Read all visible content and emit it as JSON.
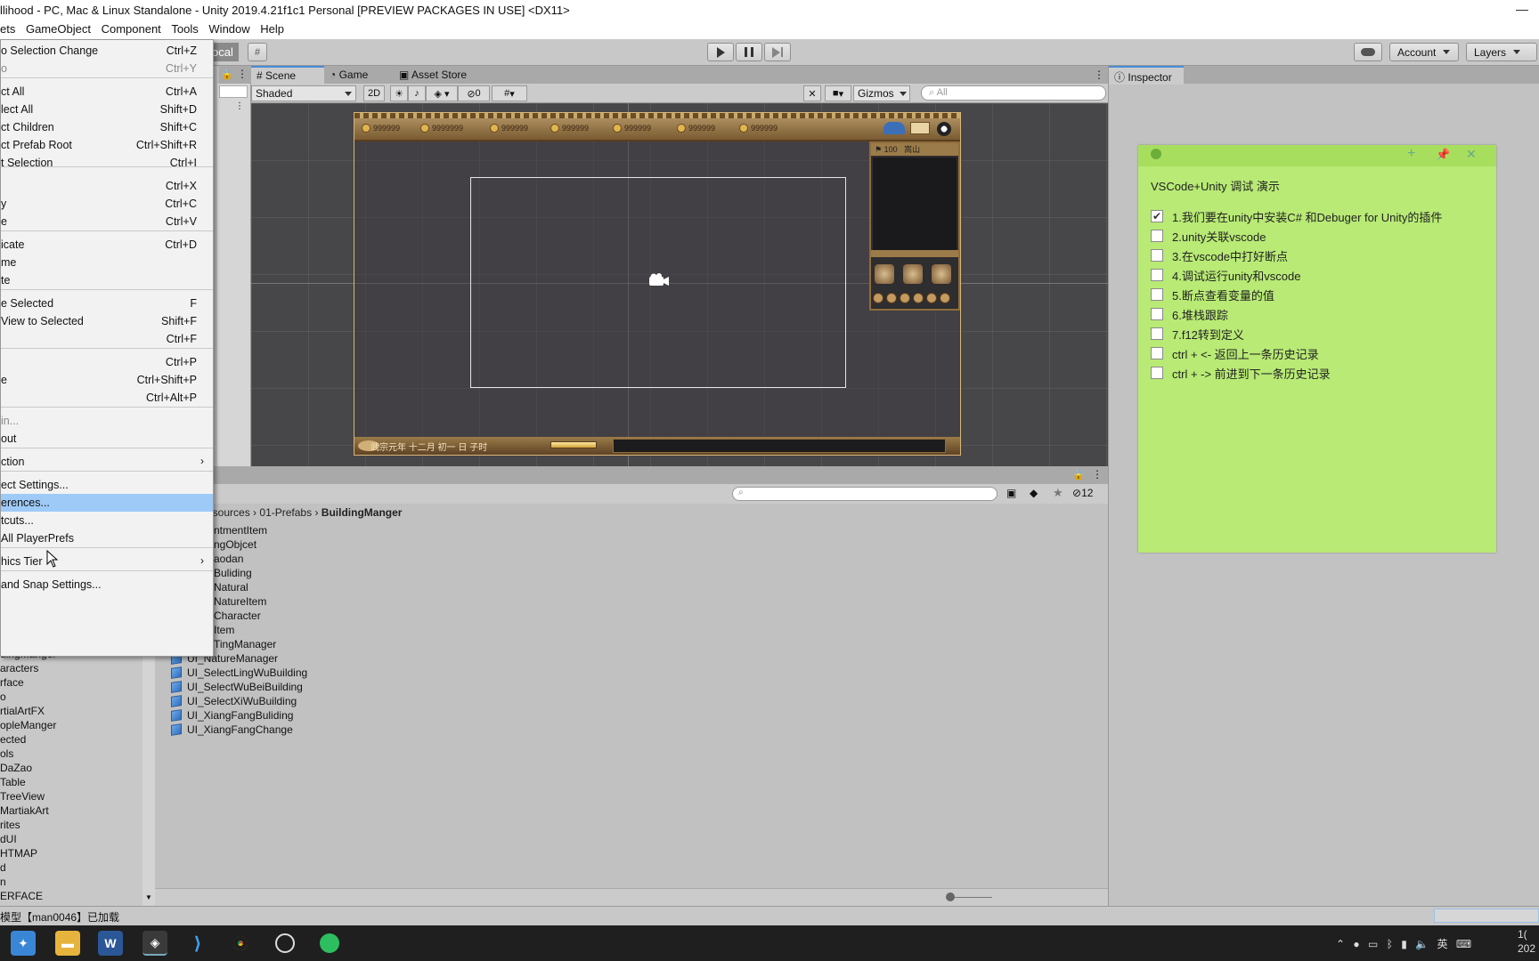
{
  "window": {
    "title": "llihood - PC, Mac & Linux Standalone - Unity 2019.4.21f1c1 Personal [PREVIEW PACKAGES IN USE] <DX11>"
  },
  "menubar": [
    "ets",
    "GameObject",
    "Component",
    "Tools",
    "Window",
    "Help"
  ],
  "toolbar": {
    "local_label": "ocal",
    "account_label": "Account",
    "layers_label": "Layers"
  },
  "edit_menu": {
    "items": [
      {
        "label": "o Selection Change",
        "shortcut": "Ctrl+Z"
      },
      {
        "label": "o",
        "shortcut": "Ctrl+Y"
      },
      {
        "label": "ct All",
        "shortcut": "Ctrl+A"
      },
      {
        "label": "lect All",
        "shortcut": "Shift+D"
      },
      {
        "label": "ct Children",
        "shortcut": "Shift+C"
      },
      {
        "label": "ct Prefab Root",
        "shortcut": "Ctrl+Shift+R"
      },
      {
        "label": "t Selection",
        "shortcut": "Ctrl+I"
      },
      {
        "label": "",
        "shortcut": "Ctrl+X"
      },
      {
        "label": "y",
        "shortcut": "Ctrl+C"
      },
      {
        "label": "e",
        "shortcut": "Ctrl+V"
      },
      {
        "label": "icate",
        "shortcut": "Ctrl+D"
      },
      {
        "label": "me",
        "shortcut": ""
      },
      {
        "label": "te",
        "shortcut": ""
      },
      {
        "label": "e Selected",
        "shortcut": "F"
      },
      {
        "label": " View to Selected",
        "shortcut": "Shift+F"
      },
      {
        "label": "",
        "shortcut": "Ctrl+F"
      },
      {
        "label": "",
        "shortcut": "Ctrl+P"
      },
      {
        "label": "e",
        "shortcut": "Ctrl+Shift+P"
      },
      {
        "label": "",
        "shortcut": "Ctrl+Alt+P"
      },
      {
        "label": "in...",
        "shortcut": ""
      },
      {
        "label": "out",
        "shortcut": ""
      },
      {
        "label": "ction",
        "shortcut": ""
      },
      {
        "label": "ect Settings...",
        "shortcut": ""
      },
      {
        "label": "erences...",
        "shortcut": ""
      },
      {
        "label": "tcuts...",
        "shortcut": ""
      },
      {
        "label": " All PlayerPrefs",
        "shortcut": ""
      },
      {
        "label": "hics Tier",
        "shortcut": ""
      },
      {
        "label": " and Snap Settings...",
        "shortcut": ""
      }
    ]
  },
  "scene_tabs": {
    "scene": "Scene",
    "game": "Game",
    "asset_store": "Asset Store"
  },
  "scene_tools": {
    "shading": "Shaded",
    "mode2d": "2D",
    "hidden_count": "0",
    "gizmos": "Gizmos",
    "search_placeholder": "All"
  },
  "game_view": {
    "resources": [
      "999999",
      "9999999",
      "999999",
      "999999",
      "999999",
      "999999",
      "999999"
    ],
    "minimap_value": "100",
    "minimap_place": "嵩山",
    "date_text": "武宗元年 十二月 初一 日 子时"
  },
  "inspector": {
    "tab": "Inspector"
  },
  "sticky": {
    "title": "VSCode+Unity 调试 演示",
    "items": [
      {
        "text": "1.我们要在unity中安装C# 和Debuger for Unity的插件",
        "checked": true
      },
      {
        "text": "2.unity关联vscode",
        "checked": false
      },
      {
        "text": "3.在vscode中打好断点",
        "checked": false
      },
      {
        "text": "4.调试运行unity和vscode",
        "checked": false
      },
      {
        "text": "5.断点查看变量的值",
        "checked": false
      },
      {
        "text": "6.堆栈跟踪",
        "checked": false
      },
      {
        "text": "7.f12转到定义",
        "checked": false
      },
      {
        "text": "ctrl + <- 返回上一条历史记录",
        "checked": false
      },
      {
        "text": "ctrl + -> 前进到下一条历史记录",
        "checked": false
      }
    ]
  },
  "project": {
    "breadcrumb": [
      "esources",
      "01-Prefabs",
      "BuildingManger"
    ],
    "hidden_count": "12",
    "files_partial": [
      "ntmentItem",
      "ngObjcet",
      "aodan",
      "Buliding",
      "Natural",
      "NatureItem",
      "Character",
      "Item",
      "TingManager"
    ],
    "files": [
      "UI_NatureManager",
      "UI_SelectLingWuBuilding",
      "UI_SelectWuBeiBuilding",
      "UI_SelectXiWuBuilding",
      "UI_XiangFangBuliding",
      "UI_XiangFangChange"
    ],
    "folders": [
      "dingManger",
      "aracters",
      "rface",
      "o",
      "rtialArtFX",
      "opleManger",
      "ected",
      "ols",
      "DaZao",
      "Table",
      "TreeView",
      "MartiakArt",
      "rites",
      "dUI",
      "HTMAP",
      "d",
      "n",
      "ERFACE"
    ]
  },
  "status": {
    "message": "模型【man0046】已加载"
  },
  "taskbar": {
    "ime": "英",
    "clock_top": "1(",
    "clock_bottom": "202"
  }
}
